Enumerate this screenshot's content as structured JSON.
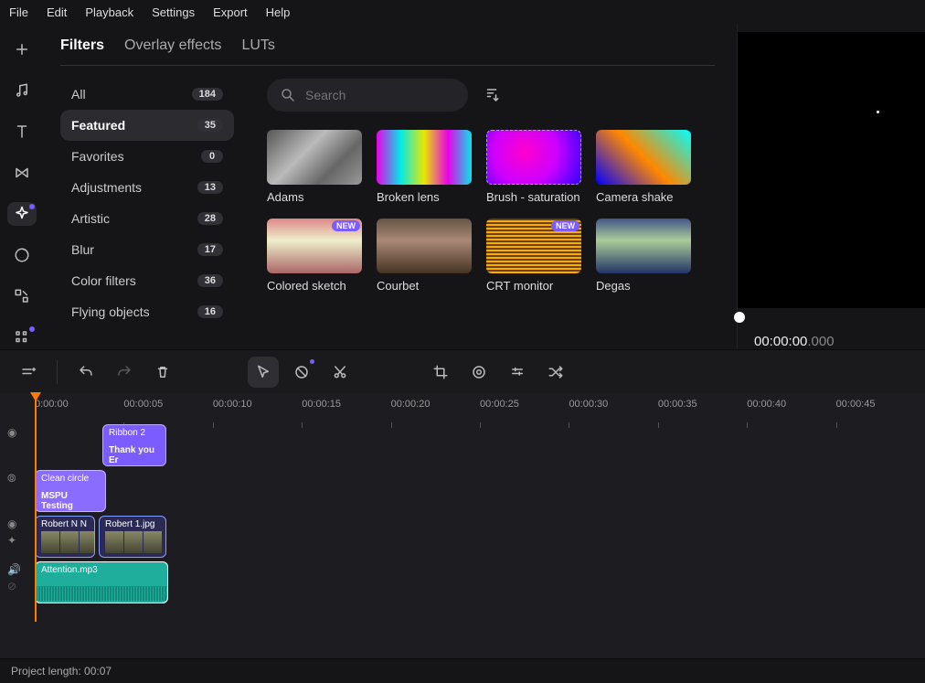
{
  "menu": {
    "file": "File",
    "edit": "Edit",
    "playback": "Playback",
    "settings": "Settings",
    "export": "Export",
    "help": "Help"
  },
  "tabs": {
    "filters": "Filters",
    "overlay": "Overlay effects",
    "luts": "LUTs"
  },
  "search": {
    "placeholder": "Search"
  },
  "categories": [
    {
      "label": "All",
      "count": "184"
    },
    {
      "label": "Featured",
      "count": "35"
    },
    {
      "label": "Favorites",
      "count": "0"
    },
    {
      "label": "Adjustments",
      "count": "13"
    },
    {
      "label": "Artistic",
      "count": "28"
    },
    {
      "label": "Blur",
      "count": "17"
    },
    {
      "label": "Color filters",
      "count": "36"
    },
    {
      "label": "Flying objects",
      "count": "16"
    }
  ],
  "filters": [
    {
      "label": "Adams"
    },
    {
      "label": "Broken lens"
    },
    {
      "label": "Brush - saturation"
    },
    {
      "label": "Camera shake"
    },
    {
      "label": "Colored sketch",
      "new": "NEW"
    },
    {
      "label": "Courbet"
    },
    {
      "label": "CRT monitor",
      "new": "NEW"
    },
    {
      "label": "Degas"
    }
  ],
  "preview": {
    "time_main": "00:00:00",
    "time_ms": ".000"
  },
  "ruler": [
    "0:00:00",
    "00:00:05",
    "00:00:10",
    "00:00:15",
    "00:00:20",
    "00:00:25",
    "00:00:30",
    "00:00:35",
    "00:00:40",
    "00:00:45"
  ],
  "clips": {
    "ribbon_title": "Ribbon 2",
    "ribbon_sub": "Thank you Er",
    "clean_title": "Clean circle",
    "clean_sub": "MSPU Testing",
    "media1": "Robert  N N",
    "media2": "Robert 1.jpg",
    "audio": "Attention.mp3"
  },
  "status": {
    "project_length": "Project length: 00:07"
  }
}
